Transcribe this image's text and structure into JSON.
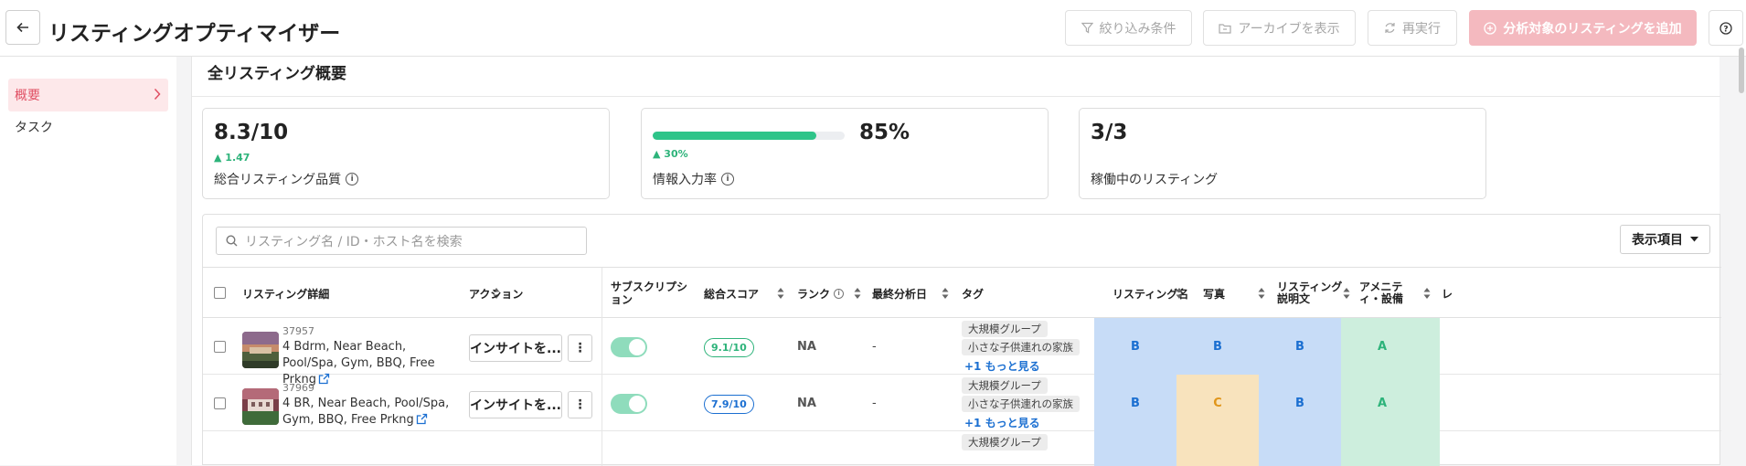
{
  "header": {
    "title": "リスティングオプティマイザー",
    "buttons": {
      "filter": "絞り込み条件",
      "archive": "アーカイブを表示",
      "rerun": "再実行",
      "add": "分析対象のリスティングを追加"
    }
  },
  "sidebar": {
    "items": [
      {
        "label": "概要",
        "active": true
      },
      {
        "label": "タスク",
        "active": false
      }
    ]
  },
  "main": {
    "section_title": "全リスティング概要",
    "cards": {
      "quality": {
        "value": "8.3/10",
        "delta": "1.47",
        "label": "総合リスティング品質"
      },
      "completion": {
        "value": "85%",
        "progress": 0.85,
        "delta": "30%",
        "label": "情報入力率"
      },
      "active": {
        "value": "3/3",
        "label": "稼働中のリスティング"
      }
    },
    "table": {
      "search_placeholder": "リスティング名 / ID・ホスト名を検索",
      "columns_button": "表示項目",
      "headers": {
        "details": "リスティング詳細",
        "actions": "アクション",
        "subscription": "サブスクリプション",
        "total_score": "総合スコア",
        "rank": "ランク",
        "last_analysis": "最終分析日",
        "tags": "タグ",
        "listing_name": "リスティング名",
        "photos": "写真",
        "description": "リスティング説明文",
        "amenities": "アメニティ・設備",
        "next": "レ"
      },
      "rows": [
        {
          "id": "37957",
          "name": "4 Bdrm, Near Beach, Pool/Spa, Gym, BBQ, Free Prkng",
          "insight_button": "インサイトを...",
          "score": "9.1/10",
          "rank": "NA",
          "last_analysis": "-",
          "tags": [
            "大規模グループ",
            "小さな子供連れの家族"
          ],
          "more": "+1 もっと見る",
          "grades": {
            "listing_name": "B",
            "photos": "B",
            "description": "B",
            "amenities": "A"
          }
        },
        {
          "id": "37969",
          "name": "4 BR, Near Beach, Pool/Spa, Gym, BBQ, Free Prkng",
          "insight_button": "インサイトを...",
          "score": "7.9/10",
          "rank": "NA",
          "last_analysis": "-",
          "tags": [
            "大規模グループ",
            "小さな子供連れの家族"
          ],
          "more": "+1 もっと見る",
          "grades": {
            "listing_name": "B",
            "photos": "C",
            "description": "B",
            "amenities": "A"
          }
        }
      ],
      "partial_row_tag": "大規模グループ"
    }
  },
  "colors": {
    "accent": "#e04f63",
    "grade_b_bg": "#c7dcf7",
    "grade_c_bg": "#f8e3bd",
    "grade_a_bg": "#cdeedd",
    "score_green": "#2db37a",
    "score_blue": "#1b6fd1"
  }
}
